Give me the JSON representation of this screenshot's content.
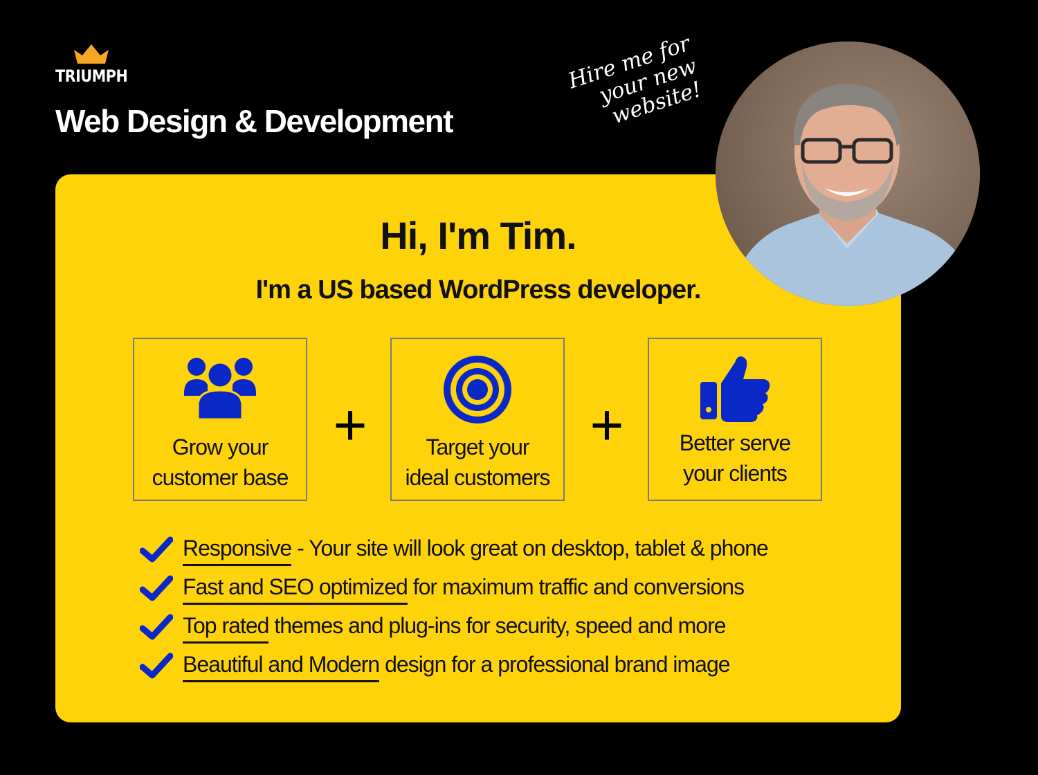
{
  "brand": {
    "logo_text": "TRIUMPH",
    "crown_color": "#f5a623"
  },
  "header": {
    "title": "Web Design & Development"
  },
  "tagline": {
    "line1": "Hire me for",
    "line2": "your new",
    "line3": "website!"
  },
  "hero": {
    "title": "Hi, I'm Tim.",
    "subtitle": "I'm a US based WordPress developer."
  },
  "features": [
    {
      "icon": "users-group-icon",
      "line1": "Grow your",
      "line2": "customer base"
    },
    {
      "icon": "target-icon",
      "line1": "Target your",
      "line2": "ideal customers"
    },
    {
      "icon": "thumbs-up-icon",
      "line1": "Better serve",
      "line2": "your clients"
    }
  ],
  "plus_symbol": "+",
  "benefits": [
    {
      "highlight": "Responsive",
      "rest": " - Your site will look great on desktop, tablet & phone"
    },
    {
      "highlight": "Fast and SEO optimized",
      "rest": " for maximum traffic and conversions"
    },
    {
      "highlight": "Top rated",
      "rest": " themes and plug-ins for security, speed and more"
    },
    {
      "highlight": "Beautiful and Modern",
      "rest": " design for a professional brand image"
    }
  ],
  "colors": {
    "background": "#000000",
    "card": "#ffd30a",
    "icon_blue": "#0a28c8",
    "text_dark": "#111111"
  }
}
